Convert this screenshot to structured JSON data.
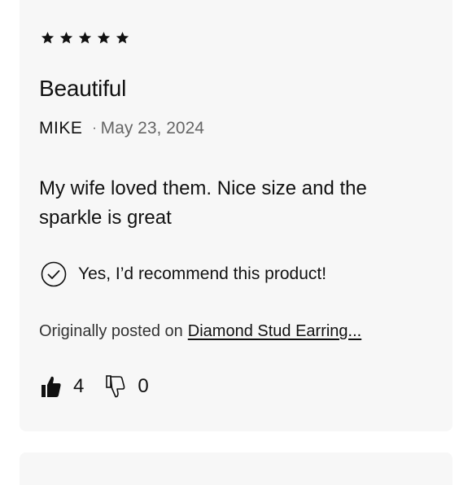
{
  "review": {
    "rating": 5,
    "rating_max": 5,
    "title": "Beautiful",
    "author": "MIKE",
    "separator": "·",
    "date": "May 23, 2024",
    "body": "My wife loved them. Nice size and the sparkle is great",
    "recommend_text": "Yes, I’d recommend this product!",
    "origin_prefix": "Originally posted on",
    "origin_link": "Diamond Stud Earring...",
    "helpful_count": "4",
    "unhelpful_count": "0"
  },
  "icons": {
    "star": "star-icon",
    "recommend": "check-circle-icon",
    "helpful": "thumbs-up-icon",
    "unhelpful": "thumbs-down-icon"
  },
  "colors": {
    "card_background": "#f7f7f7",
    "text": "#111111",
    "muted_text": "#666666"
  }
}
